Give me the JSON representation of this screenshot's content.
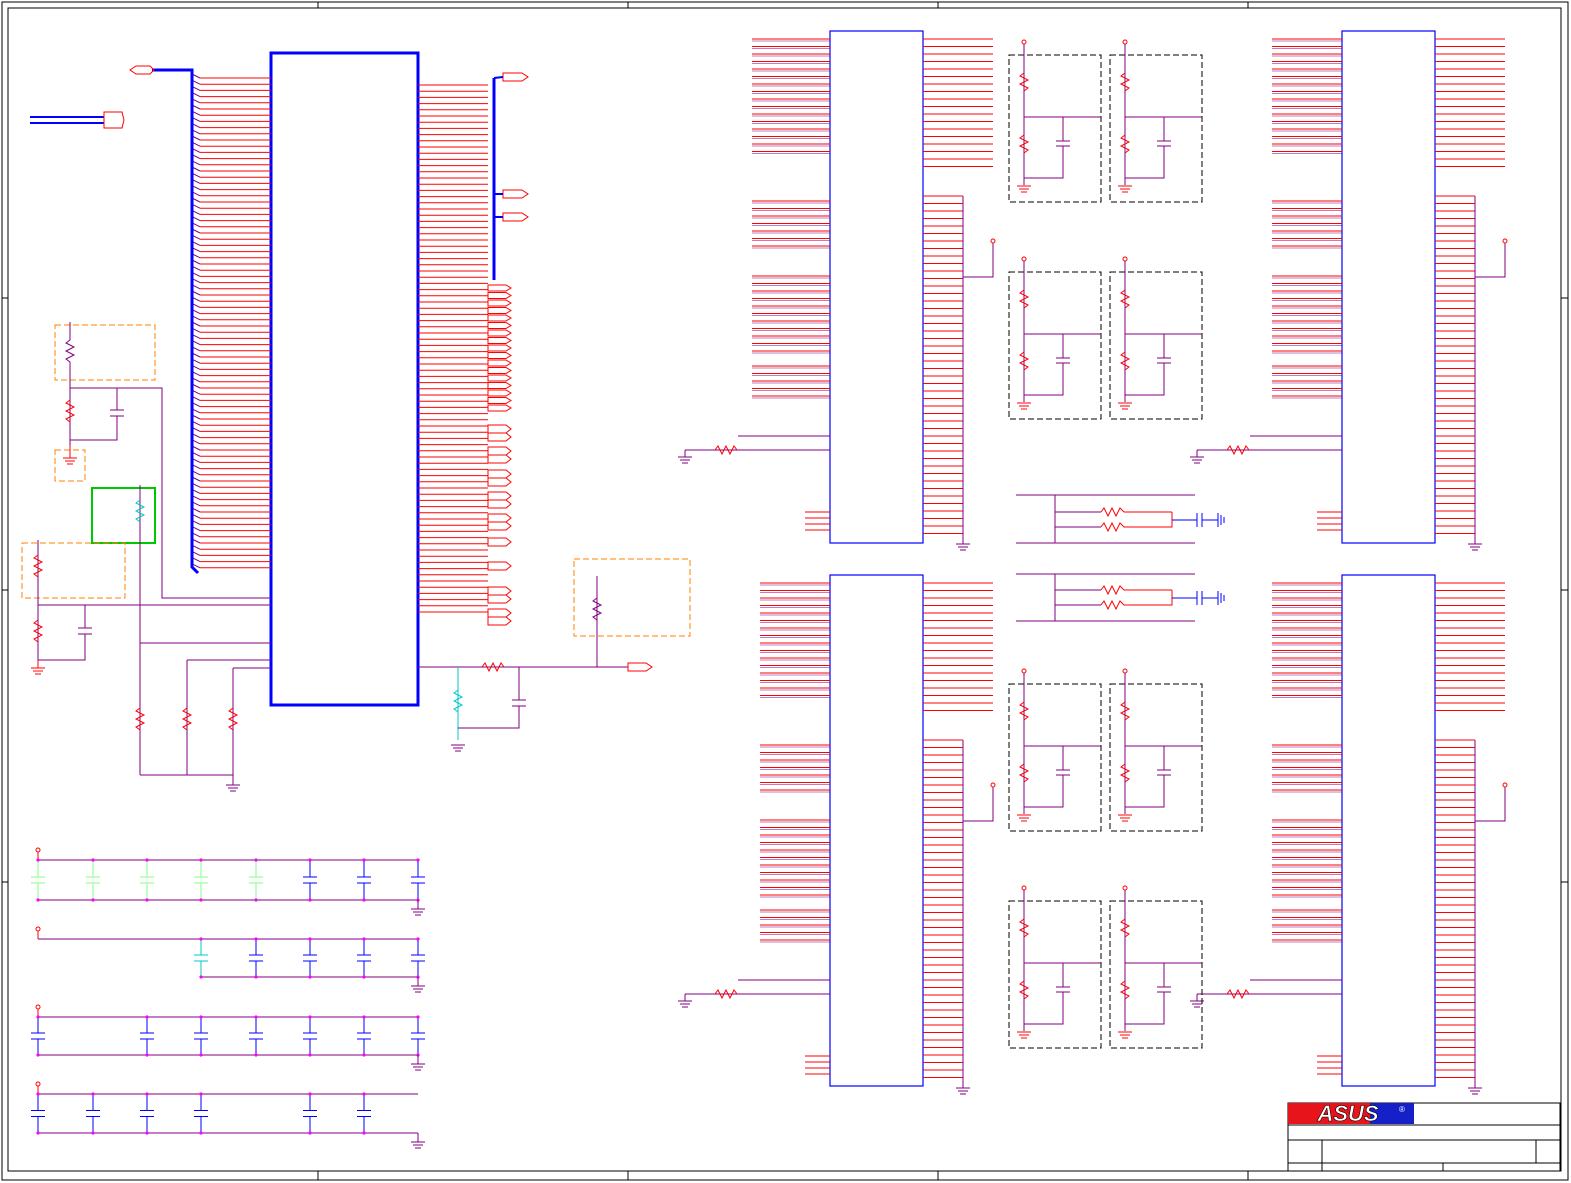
{
  "title_block": {
    "logo_text": "ASUS",
    "registered_mark": "®",
    "colors": {
      "logo_red": "#e8141b",
      "logo_blue": "#1520c8"
    }
  },
  "colors": {
    "wire_red": "#ff0000",
    "wire_purple": "#800080",
    "ic_outline": "#0000ff",
    "junction": "#ff00ff",
    "border": "#000000",
    "group_orange": "#ff8000",
    "group_green": "#00c800",
    "group_black": "#000000"
  },
  "schematic": {
    "blocks": [
      {
        "id": "U-main",
        "kind": "ic"
      },
      {
        "id": "U-ram-top-left",
        "kind": "ic"
      },
      {
        "id": "U-ram-top-right",
        "kind": "ic"
      },
      {
        "id": "U-ram-bottom-left",
        "kind": "ic"
      },
      {
        "id": "U-ram-bottom-right",
        "kind": "ic"
      }
    ],
    "decoupling_rows": 4
  }
}
